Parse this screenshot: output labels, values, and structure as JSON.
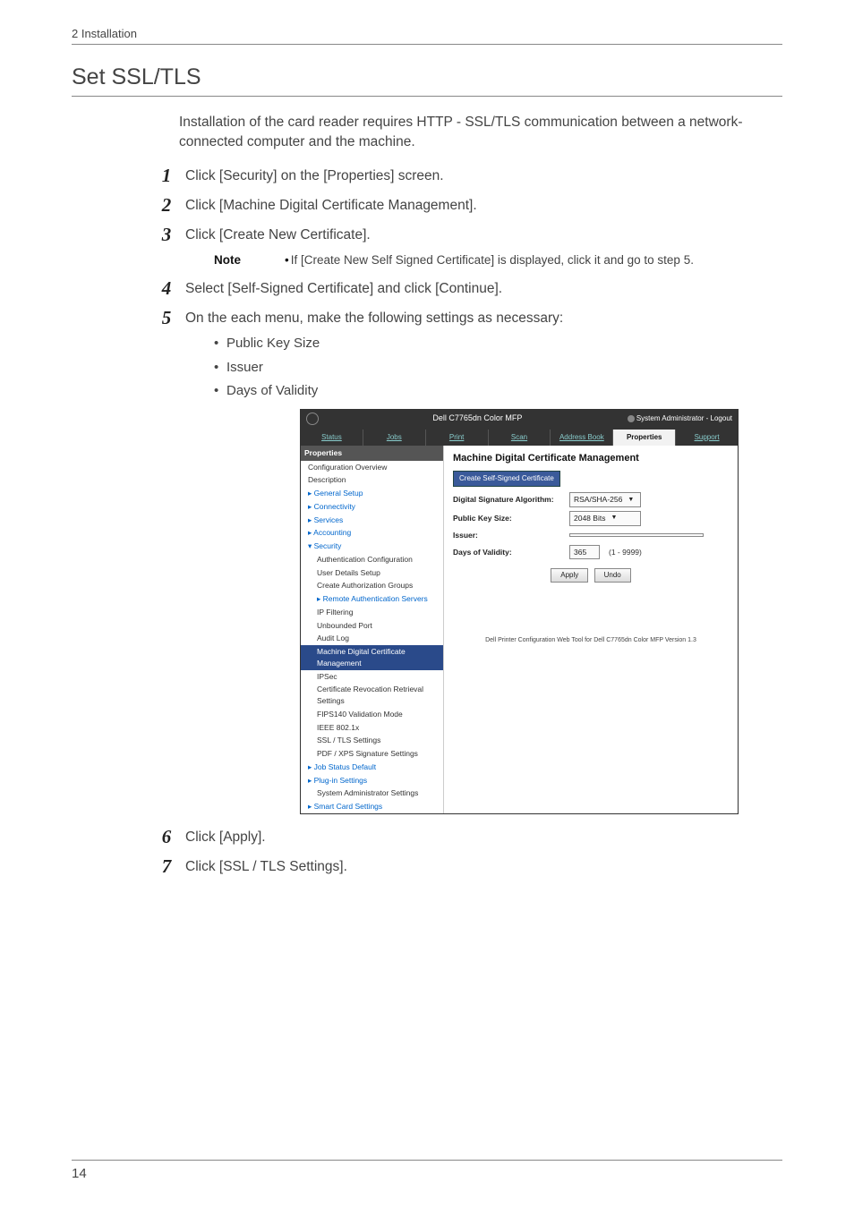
{
  "header": {
    "chapter": "2 Installation"
  },
  "section_title": "Set SSL/TLS",
  "intro": "Installation of the card reader requires HTTP - SSL/TLS communication between a network-connected computer and the machine.",
  "steps": {
    "1": "Click [Security] on the [Properties] screen.",
    "2": "Click [Machine Digital Certificate Management].",
    "3": "Click [Create New Certificate].",
    "4": "Select [Self-Signed Certificate] and click [Continue].",
    "5": "On the each menu, make the following settings as necessary:",
    "6": "Click [Apply].",
    "7": "Click [SSL / TLS Settings]."
  },
  "note": {
    "label": "Note",
    "text": "If [Create New Self Signed Certificate] is displayed, click it and go to step 5."
  },
  "bullets": {
    "a": "Public Key Size",
    "b": "Issuer",
    "c": "Days of Validity"
  },
  "screenshot": {
    "window_title": "Dell C7765dn Color MFP",
    "user_status": "System Administrator - Logout",
    "tabs": {
      "status": "Status",
      "jobs": "Jobs",
      "print": "Print",
      "scan": "Scan",
      "address": "Address Book",
      "properties": "Properties",
      "support": "Support"
    },
    "sidebar": {
      "header": "Properties",
      "items": {
        "i0": "Configuration Overview",
        "i1": "Description",
        "i2": "▸ General Setup",
        "i3": "▸ Connectivity",
        "i4": "▸ Services",
        "i5": "▸ Accounting",
        "i6": "▾ Security",
        "i7": "Authentication Configuration",
        "i8": "User Details Setup",
        "i9": "Create Authorization Groups",
        "i10": "▸ Remote Authentication Servers",
        "i11": "IP Filtering",
        "i12": "Unbounded Port",
        "i13": "Audit Log",
        "i14": "Machine Digital Certificate Management",
        "i15": "IPSec",
        "i16": "Certificate Revocation Retrieval Settings",
        "i17": "FIPS140 Validation Mode",
        "i18": "IEEE 802.1x",
        "i19": "SSL / TLS Settings",
        "i20": "PDF / XPS Signature Settings",
        "i21": "▸ Job Status Default",
        "i22": "▸ Plug-in Settings",
        "i23": "System Administrator Settings",
        "i24": "▸ Smart Card Settings"
      }
    },
    "main": {
      "title": "Machine Digital Certificate Management",
      "create_button": "Create Self-Signed Certificate",
      "rows": {
        "alg_label": "Digital Signature Algorithm:",
        "alg_value": "RSA/SHA-256",
        "key_label": "Public Key Size:",
        "key_value": "2048 Bits",
        "issuer_label": "Issuer:",
        "issuer_value": "",
        "days_label": "Days of Validity:",
        "days_value": "365",
        "days_range": "(1 - 9999)"
      },
      "apply": "Apply",
      "undo": "Undo",
      "footer": "Dell Printer Configuration Web Tool for Dell C7765dn Color MFP Version 1.3"
    }
  },
  "page_number": "14"
}
